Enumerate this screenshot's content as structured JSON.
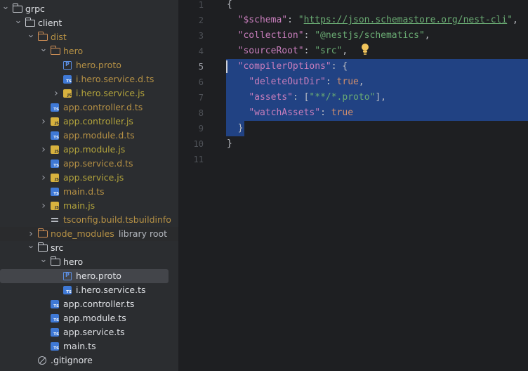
{
  "tree": {
    "rows": [
      {
        "name": "grpc",
        "icon": "folder",
        "level": 0,
        "expanded": true,
        "color": "plain"
      },
      {
        "name": "client",
        "icon": "folder",
        "level": 1,
        "expanded": true,
        "color": "plain"
      },
      {
        "name": "dist",
        "icon": "folder-excluded",
        "level": 2,
        "expanded": true,
        "color": "excl"
      },
      {
        "name": "hero",
        "icon": "folder-excluded",
        "level": 3,
        "expanded": true,
        "color": "excl"
      },
      {
        "name": "hero.proto",
        "icon": "proto",
        "level": 4,
        "color": "excl"
      },
      {
        "name": "i.hero.service.d.ts",
        "icon": "ts",
        "level": 4,
        "color": "excl"
      },
      {
        "name": "i.hero.service.js",
        "icon": "js",
        "level": 4,
        "collapsed": true,
        "color": "excl-js"
      },
      {
        "name": "app.controller.d.ts",
        "icon": "ts",
        "level": 3,
        "color": "excl"
      },
      {
        "name": "app.controller.js",
        "icon": "js",
        "level": 3,
        "collapsed": true,
        "color": "excl-js"
      },
      {
        "name": "app.module.d.ts",
        "icon": "ts",
        "level": 3,
        "color": "excl"
      },
      {
        "name": "app.module.js",
        "icon": "js",
        "level": 3,
        "collapsed": true,
        "color": "excl-js"
      },
      {
        "name": "app.service.d.ts",
        "icon": "ts",
        "level": 3,
        "color": "excl"
      },
      {
        "name": "app.service.js",
        "icon": "js",
        "level": 3,
        "collapsed": true,
        "color": "excl-js"
      },
      {
        "name": "main.d.ts",
        "icon": "ts",
        "level": 3,
        "color": "excl"
      },
      {
        "name": "main.js",
        "icon": "js",
        "level": 3,
        "collapsed": true,
        "color": "excl-js"
      },
      {
        "name": "tsconfig.build.tsbuildinfo",
        "icon": "tsbuildinfo",
        "level": 3,
        "color": "excl"
      },
      {
        "name": "node_modules",
        "extra": "library root",
        "icon": "folder-excluded",
        "level": 2,
        "collapsed": true,
        "color": "excl",
        "nm": true
      },
      {
        "name": "src",
        "icon": "folder",
        "level": 2,
        "expanded": true,
        "color": "plain"
      },
      {
        "name": "hero",
        "icon": "folder",
        "level": 3,
        "expanded": true,
        "color": "plain"
      },
      {
        "name": "hero.proto",
        "icon": "proto",
        "level": 4,
        "color": "plain",
        "selected": true
      },
      {
        "name": "i.hero.service.ts",
        "icon": "ts",
        "level": 4,
        "color": "plain"
      },
      {
        "name": "app.controller.ts",
        "icon": "ts",
        "level": 3,
        "color": "plain"
      },
      {
        "name": "app.module.ts",
        "icon": "ts",
        "level": 3,
        "color": "plain"
      },
      {
        "name": "app.service.ts",
        "icon": "ts",
        "level": 3,
        "color": "plain"
      },
      {
        "name": "main.ts",
        "icon": "ts",
        "level": 3,
        "color": "plain"
      },
      {
        "name": ".gitignore",
        "icon": "ignore",
        "level": 2,
        "color": "plain"
      }
    ]
  },
  "editor": {
    "current_line": 5,
    "lines": [
      {
        "n": "1",
        "tokens": [
          {
            "t": "{",
            "c": "p"
          }
        ]
      },
      {
        "n": "2",
        "tokens": [
          {
            "t": "  ",
            "c": "p"
          },
          {
            "t": "\"$schema\"",
            "c": "k"
          },
          {
            "t": ": ",
            "c": "p"
          },
          {
            "t": "\"",
            "c": "s"
          },
          {
            "t": "https://json.schemastore.org/nest-cli",
            "c": "u"
          },
          {
            "t": "\"",
            "c": "s"
          },
          {
            "t": ",",
            "c": "p"
          }
        ]
      },
      {
        "n": "3",
        "tokens": [
          {
            "t": "  ",
            "c": "p"
          },
          {
            "t": "\"collection\"",
            "c": "k"
          },
          {
            "t": ": ",
            "c": "p"
          },
          {
            "t": "\"@nestjs/schematics\"",
            "c": "s"
          },
          {
            "t": ",",
            "c": "p"
          }
        ]
      },
      {
        "n": "4",
        "tokens": [
          {
            "t": "  ",
            "c": "p"
          },
          {
            "t": "\"sourceRoot\"",
            "c": "k"
          },
          {
            "t": ": ",
            "c": "p"
          },
          {
            "t": "\"src\"",
            "c": "s"
          },
          {
            "t": ",",
            "c": "p"
          }
        ],
        "bulb": true
      },
      {
        "n": "5",
        "tokens": [
          {
            "t": "  ",
            "c": "p"
          },
          {
            "t": "\"compilerOptions\"",
            "c": "k"
          },
          {
            "t": ": {",
            "c": "p"
          }
        ],
        "sel": "full",
        "caret": true,
        "fold": true
      },
      {
        "n": "6",
        "tokens": [
          {
            "t": "    ",
            "c": "p"
          },
          {
            "t": "\"deleteOutDir\"",
            "c": "k"
          },
          {
            "t": ": ",
            "c": "p"
          },
          {
            "t": "true",
            "c": "kw"
          },
          {
            "t": ",",
            "c": "p"
          }
        ],
        "sel": "full"
      },
      {
        "n": "7",
        "tokens": [
          {
            "t": "    ",
            "c": "p"
          },
          {
            "t": "\"assets\"",
            "c": "k"
          },
          {
            "t": ": [",
            "c": "p"
          },
          {
            "t": "\"**/*.proto\"",
            "c": "s"
          },
          {
            "t": "],",
            "c": "p"
          }
        ],
        "sel": "full"
      },
      {
        "n": "8",
        "tokens": [
          {
            "t": "    ",
            "c": "p"
          },
          {
            "t": "\"watchAssets\"",
            "c": "k"
          },
          {
            "t": ": ",
            "c": "p"
          },
          {
            "t": "true",
            "c": "kw"
          }
        ],
        "sel": "full"
      },
      {
        "n": "9",
        "tokens": [
          {
            "t": "  }",
            "c": "p"
          }
        ],
        "sel": "part",
        "fold": true
      },
      {
        "n": "10",
        "tokens": [
          {
            "t": "}",
            "c": "p"
          }
        ]
      },
      {
        "n": "11",
        "tokens": []
      }
    ]
  }
}
